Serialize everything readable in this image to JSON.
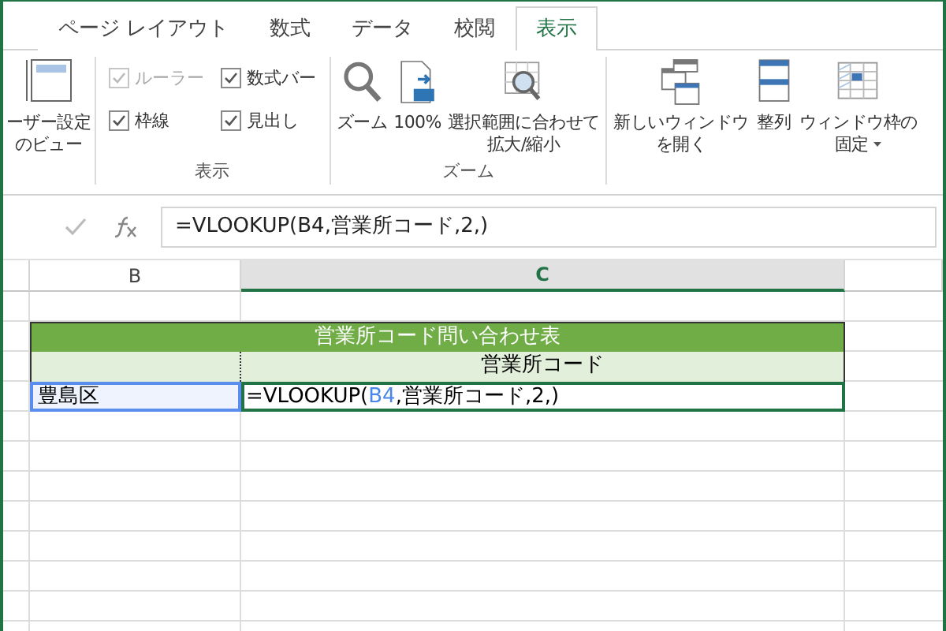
{
  "tabs": [
    {
      "label": "ページ レイアウト",
      "selected": false
    },
    {
      "label": "数式",
      "selected": false
    },
    {
      "label": "データ",
      "selected": false
    },
    {
      "label": "校閲",
      "selected": false
    },
    {
      "label": "表示",
      "selected": true
    }
  ],
  "ribbon": {
    "groups": [
      {
        "kind": "views",
        "buttons": [
          {
            "lines": [
              "ーザー設定",
              "のビュー"
            ]
          }
        ]
      },
      {
        "kind": "show",
        "label": "表示",
        "checkboxes": [
          {
            "label": "ルーラー",
            "checked": true,
            "disabled": true
          },
          {
            "label": "数式バー",
            "checked": true,
            "disabled": false
          },
          {
            "label": "枠線",
            "checked": true,
            "disabled": false
          },
          {
            "label": "見出し",
            "checked": true,
            "disabled": false
          }
        ]
      },
      {
        "kind": "zoom",
        "label": "ズーム",
        "buttons": [
          {
            "lines": [
              "ズーム"
            ]
          },
          {
            "lines": [
              "100%"
            ]
          },
          {
            "lines": [
              "選択範囲に合わせて",
              "拡大/縮小"
            ]
          }
        ]
      },
      {
        "kind": "window",
        "buttons": [
          {
            "lines": [
              "新しいウィンドウ",
              "を開く"
            ]
          },
          {
            "lines": [
              "整列"
            ]
          },
          {
            "lines": [
              "ウィンドウ枠の",
              "固定"
            ],
            "dropdown": true
          }
        ]
      }
    ]
  },
  "formula_bar": {
    "value": "=VLOOKUP(B4,営業所コード,2,)"
  },
  "sheet": {
    "columns": [
      {
        "label": "B",
        "selected": false
      },
      {
        "label": "C",
        "selected": true
      }
    ],
    "title": "営業所コード問い合わせ表",
    "header": "営業所コード",
    "data_row": {
      "key": "豊島区",
      "formula_parts": [
        {
          "kind": "text",
          "text": "=VLOOKUP("
        },
        {
          "kind": "ref",
          "text": "B4"
        },
        {
          "kind": "text",
          "text": ",営業所コード,2,)"
        }
      ]
    }
  }
}
